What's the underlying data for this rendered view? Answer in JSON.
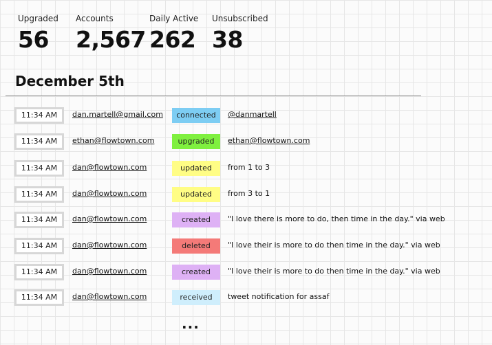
{
  "stats": [
    {
      "label": "Upgraded",
      "value": "56"
    },
    {
      "label": "Accounts",
      "value": "2,567"
    },
    {
      "label": "Daily Active",
      "value": "262"
    },
    {
      "label": "Unsubscribed",
      "value": "38"
    }
  ],
  "date_heading": "December 5th",
  "status_colors": {
    "connected": "#7dcdf3",
    "upgraded": "#7ff03f",
    "updated": "#fffd85",
    "created": "#deb1f5",
    "deleted": "#f47a78",
    "received": "#cfeefc"
  },
  "activity": [
    {
      "time": "11:34 AM",
      "email": "dan.martell@gmail.com",
      "status": "connected",
      "detail": "@danmartell"
    },
    {
      "time": "11:34 AM",
      "email": "ethan@flowtown.com",
      "status": "upgraded",
      "detail": "ethan@flowtown.com"
    },
    {
      "time": "11:34 AM",
      "email": "dan@flowtown.com",
      "status": "updated",
      "detail": "from 1 to 3"
    },
    {
      "time": "11:34 AM",
      "email": "dan@flowtown.com",
      "status": "updated",
      "detail": "from 3 to 1"
    },
    {
      "time": "11:34 AM",
      "email": "dan@flowtown.com",
      "status": "created",
      "detail": "\"I love there is more to do, then time in the day.\" via web"
    },
    {
      "time": "11:34 AM",
      "email": "dan@flowtown.com",
      "status": "deleted",
      "detail": "\"I love their is more to do then time in the day.\" via web"
    },
    {
      "time": "11:34 AM",
      "email": "dan@flowtown.com",
      "status": "created",
      "detail": "\"I love their is more to do then time in the day.\" via web"
    },
    {
      "time": "11:34 AM",
      "email": "dan@flowtown.com",
      "status": "received",
      "detail": "tweet notification for assaf"
    }
  ],
  "more_label": "..."
}
